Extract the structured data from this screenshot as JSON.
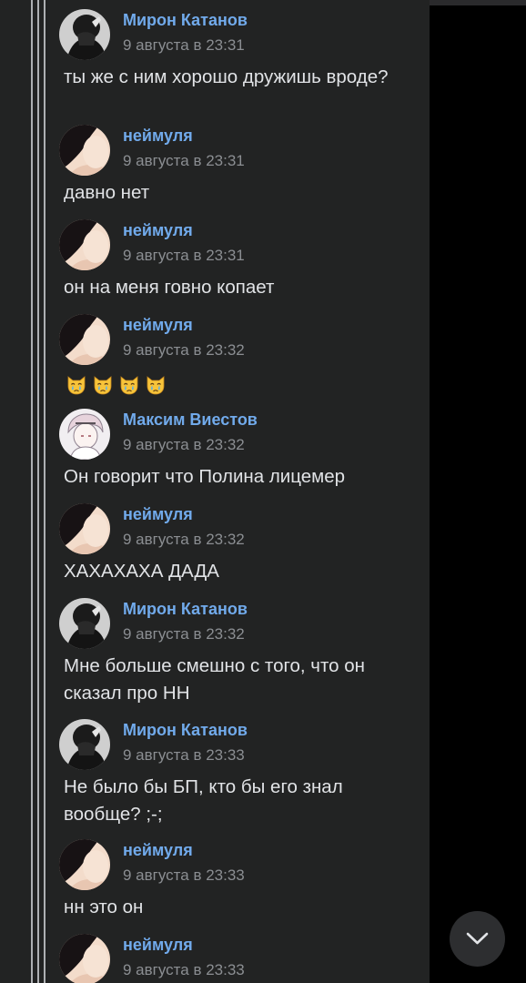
{
  "comments": [
    {
      "author": "Мирон Катанов",
      "date": "9 августа в 23:31",
      "text": "ты же с ним хорошо дружишь вроде?",
      "avatar": "miron"
    },
    {
      "author": "неймуля",
      "date": "9 августа в 23:31",
      "text": "давно нет",
      "avatar": "neymulya"
    },
    {
      "author": "неймуля",
      "date": "9 августа в 23:31",
      "text": "он на меня говно копает",
      "avatar": "neymulya"
    },
    {
      "author": "неймуля",
      "date": "9 августа в 23:32",
      "text": "",
      "emoji": [
        "crying-cat-emoji",
        "crying-cat-emoji",
        "crying-cat-emoji",
        "crying-cat-emoji"
      ],
      "avatar": "neymulya"
    },
    {
      "author": "Максим Виестов",
      "date": "9 августа в 23:32",
      "text": "Он говорит что Полина лицемер",
      "avatar": "maxim"
    },
    {
      "author": "неймуля",
      "date": "9 августа в 23:32",
      "text": "ХАХАХАХА ДАДА",
      "avatar": "neymulya"
    },
    {
      "author": "Мирон Катанов",
      "date": "9 августа в 23:32",
      "text": "Мне больше смешно с того, что он сказал про НН",
      "avatar": "miron"
    },
    {
      "author": "Мирон Катанов",
      "date": "9 августа в 23:33",
      "text": "Не было бы БП, кто бы его знал вообще? ;-;",
      "avatar": "miron"
    },
    {
      "author": "неймуля",
      "date": "9 августа в 23:33",
      "text": "нн это он",
      "avatar": "neymulya"
    },
    {
      "author": "неймуля",
      "date": "9 августа в 23:33",
      "text": "",
      "avatar": "neymulya"
    }
  ],
  "scroll_down_icon": "chevron-down-icon",
  "colors": {
    "background": "#000000",
    "panel": "#222323",
    "author": "#71aaeb",
    "date": "#8b8e92",
    "text": "#e1e3e6",
    "thread_line": "#aeb0b3"
  }
}
